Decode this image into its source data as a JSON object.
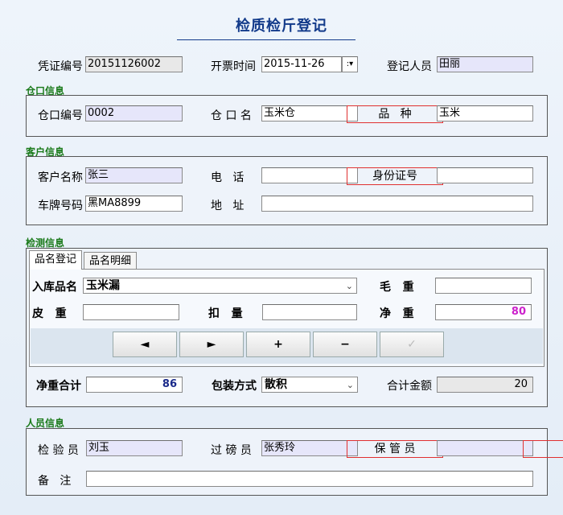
{
  "title": "检质检斤登记",
  "header": {
    "voucher_label": "凭证编号",
    "voucher_value": "20151126002",
    "bill_time_label": "开票时间",
    "bill_time_value": "2015-11-26",
    "registrar_label": "登记人员",
    "registrar_value": "田丽"
  },
  "warehouse": {
    "section": "仓口信息",
    "no_label": "仓口编号",
    "no_value": "0002",
    "name_label": "仓 口 名",
    "name_value": "玉米仓",
    "variety_label": "品   种",
    "variety_value": "玉米"
  },
  "customer": {
    "section": "客户信息",
    "name_label": "客户名称",
    "name_value": "张三",
    "phone_label": "电   话",
    "phone_value": "",
    "id_label": "身份证号",
    "id_value": "",
    "plate_label": "车牌号码",
    "plate_value": "黑MA8899",
    "address_label": "地   址",
    "address_value": ""
  },
  "inspection": {
    "section": "检测信息",
    "tabs": [
      "品名登记",
      "品名明细"
    ],
    "product_label": "入库品名",
    "product_value": "玉米漏",
    "gross_label": "毛   重",
    "gross_value": "",
    "tare_label": "皮   重",
    "tare_value": "",
    "deduct_label": "扣   量",
    "deduct_value": "",
    "net_label": "净   重",
    "net_value": "80",
    "nav": [
      "◄",
      "►",
      "+",
      "−",
      "✓"
    ],
    "net_total_label": "净重合计",
    "net_total_value": "86",
    "packing_label": "包装方式",
    "packing_value": "散积",
    "amount_label": "合计金额",
    "amount_value": "20"
  },
  "personnel": {
    "section": "人员信息",
    "inspector_label": "检 验 员",
    "inspector_value": "刘玉",
    "weigher_label": "过 磅 员",
    "weigher_value": "张秀玲",
    "keeper_label": "保 管 员",
    "keeper_value": "",
    "remark_label": "备   注",
    "remark_value": ""
  },
  "colors": {
    "title": "#123a8a",
    "section": "#1a7a1a",
    "highlight_box": "#e03030",
    "net_value": "#cc22cc",
    "net_total_value": "#1a2a8a"
  }
}
